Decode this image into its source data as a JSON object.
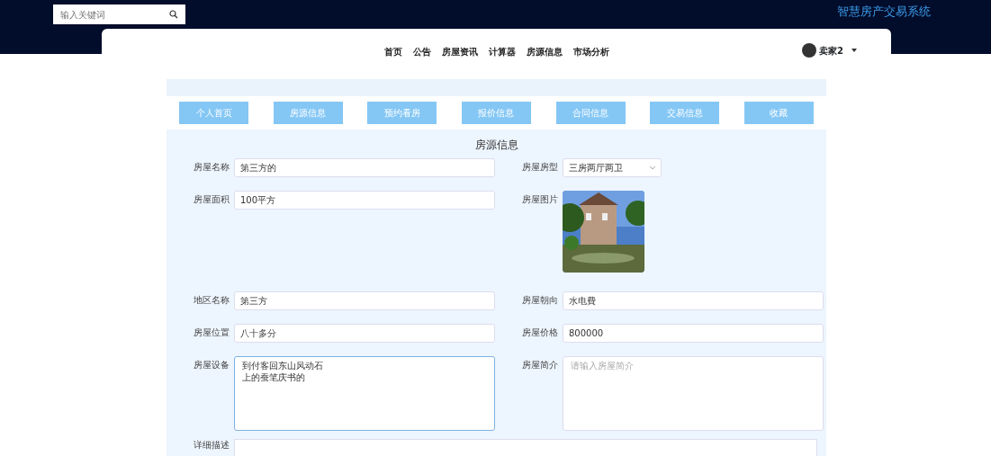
{
  "header": {
    "search": {
      "placeholder": "输入关键词"
    },
    "site_title": "智慧房产交易系统"
  },
  "nav": {
    "items": [
      {
        "label": "首页"
      },
      {
        "label": "公告"
      },
      {
        "label": "房屋资讯"
      },
      {
        "label": "计算器"
      },
      {
        "label": "房源信息"
      },
      {
        "label": "市场分析"
      }
    ],
    "user": "卖家2"
  },
  "tabs": [
    {
      "label": "个人首页"
    },
    {
      "label": "房源信息"
    },
    {
      "label": "预约看房"
    },
    {
      "label": "报价信息"
    },
    {
      "label": "合同信息"
    },
    {
      "label": "交易信息"
    },
    {
      "label": "收藏"
    }
  ],
  "form": {
    "title": "房源信息",
    "left": [
      {
        "label": "房屋名称",
        "kind": "input",
        "value": "第三方的"
      },
      {
        "label": "房屋面积",
        "kind": "input",
        "value": "100平方"
      }
    ],
    "right": [
      {
        "label": "房屋房型",
        "kind": "select",
        "value": "三房两厅两卫"
      },
      {
        "label": "房屋图片"
      }
    ],
    "rows": [
      {
        "left": {
          "label": "地区名称",
          "kind": "input",
          "value": "第三方"
        },
        "right": {
          "label": "房屋朝向",
          "kind": "input",
          "value": "水电費"
        }
      },
      {
        "left": {
          "label": "房屋位置",
          "kind": "input",
          "value": "八十多分"
        },
        "right": {
          "label": "房屋价格",
          "kind": "input",
          "value": "800000"
        }
      },
      {
        "left": {
          "label": "房屋设备",
          "kind": "textarea",
          "lines": [
            "到付客回东山风动石",
            "上的蚕笔庆书的"
          ],
          "focused": true
        },
        "right": {
          "label": "房屋简介",
          "kind": "textarea",
          "placeholder": "请输入房屋简介",
          "focused": false
        }
      }
    ],
    "editor": {
      "label": "详细描述"
    }
  }
}
